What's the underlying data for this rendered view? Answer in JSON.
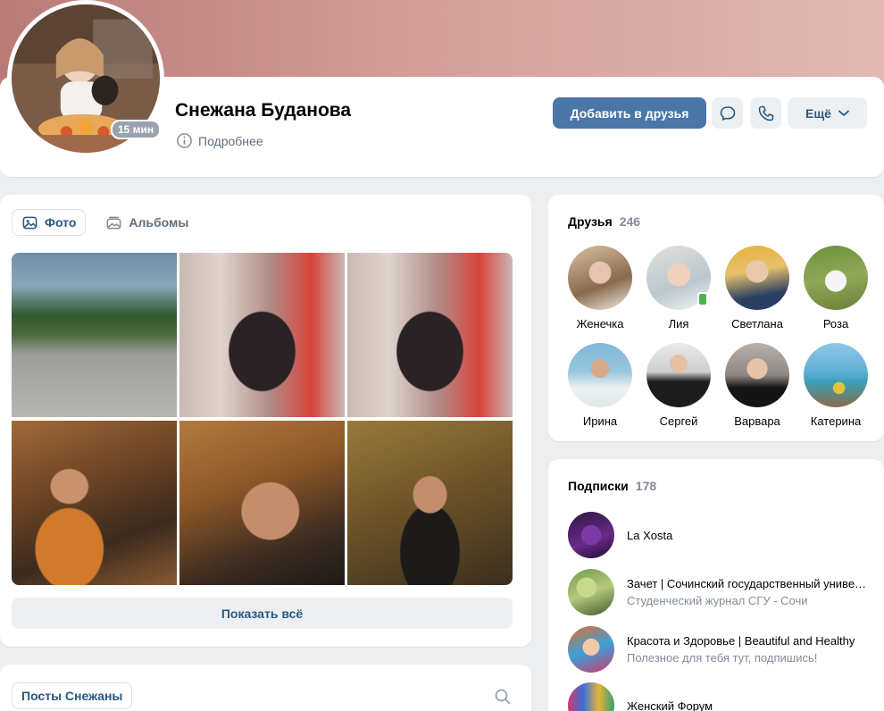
{
  "profile": {
    "name": "Снежана Буданова",
    "online_badge": "15 мин",
    "more_info": "Подробнее",
    "add_friend": "Добавить в друзья",
    "more_menu": "Ещё"
  },
  "photos": {
    "tabs": [
      {
        "label": "Фото",
        "icon": "photo-icon",
        "active": true
      },
      {
        "label": "Альбомы",
        "icon": "albums-icon",
        "active": false
      }
    ],
    "show_all": "Показать всё"
  },
  "posts": {
    "tab_label": "Посты Снежаны"
  },
  "friends": {
    "title": "Друзья",
    "count": "246",
    "items": [
      {
        "name": "Женечка",
        "online": false
      },
      {
        "name": "Лия",
        "online": true
      },
      {
        "name": "Светлана",
        "online": false
      },
      {
        "name": "Роза",
        "online": false
      },
      {
        "name": "Ирина",
        "online": false
      },
      {
        "name": "Сергей",
        "online": false
      },
      {
        "name": "Варвара",
        "online": false
      },
      {
        "name": "Катерина",
        "online": false
      }
    ]
  },
  "subscriptions": {
    "title": "Подписки",
    "count": "178",
    "items": [
      {
        "name": "La Xosta",
        "desc": ""
      },
      {
        "name": "Зачет | Сочинский государственный университет",
        "desc": "Студенческий журнал СГУ - Сочи"
      },
      {
        "name": "Красота и Здоровье | Beautiful and Healthy",
        "desc": "Полезное для тебя тут, подпишись!"
      },
      {
        "name": "Женский Форум",
        "desc": ""
      }
    ]
  },
  "colors": {
    "accent": "#4a76a8",
    "link": "#2a5885",
    "secondary_text": "#818c99",
    "online": "#4bb34b"
  }
}
